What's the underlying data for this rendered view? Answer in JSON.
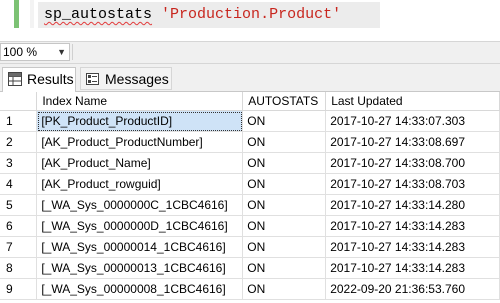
{
  "editor": {
    "command": "sp_autostats",
    "argument": "'Production.Product'"
  },
  "zoom": {
    "value": "100 %",
    "arrow_icon": "chevron-down-icon"
  },
  "tabs": [
    {
      "label": "Results",
      "icon": "grid-icon",
      "active": true
    },
    {
      "label": "Messages",
      "icon": "messages-icon",
      "active": false
    }
  ],
  "grid": {
    "columns": [
      "",
      "Index Name",
      "AUTOSTATS",
      "Last Updated"
    ],
    "rows": [
      {
        "num": "1",
        "index_name": "[PK_Product_ProductID]",
        "autostats": "ON",
        "last_updated": "2017-10-27 14:33:07.303"
      },
      {
        "num": "2",
        "index_name": "[AK_Product_ProductNumber]",
        "autostats": "ON",
        "last_updated": "2017-10-27 14:33:08.697"
      },
      {
        "num": "3",
        "index_name": "[AK_Product_Name]",
        "autostats": "ON",
        "last_updated": "2017-10-27 14:33:08.700"
      },
      {
        "num": "4",
        "index_name": "[AK_Product_rowguid]",
        "autostats": "ON",
        "last_updated": "2017-10-27 14:33:08.703"
      },
      {
        "num": "5",
        "index_name": "[_WA_Sys_0000000C_1CBC4616]",
        "autostats": "ON",
        "last_updated": "2017-10-27 14:33:14.280"
      },
      {
        "num": "6",
        "index_name": "[_WA_Sys_0000000D_1CBC4616]",
        "autostats": "ON",
        "last_updated": "2017-10-27 14:33:14.283"
      },
      {
        "num": "7",
        "index_name": "[_WA_Sys_00000014_1CBC4616]",
        "autostats": "ON",
        "last_updated": "2017-10-27 14:33:14.283"
      },
      {
        "num": "8",
        "index_name": "[_WA_Sys_00000013_1CBC4616]",
        "autostats": "ON",
        "last_updated": "2017-10-27 14:33:14.283"
      },
      {
        "num": "9",
        "index_name": "[_WA_Sys_00000008_1CBC4616]",
        "autostats": "ON",
        "last_updated": "2022-09-20 21:36:53.760"
      }
    ]
  }
}
